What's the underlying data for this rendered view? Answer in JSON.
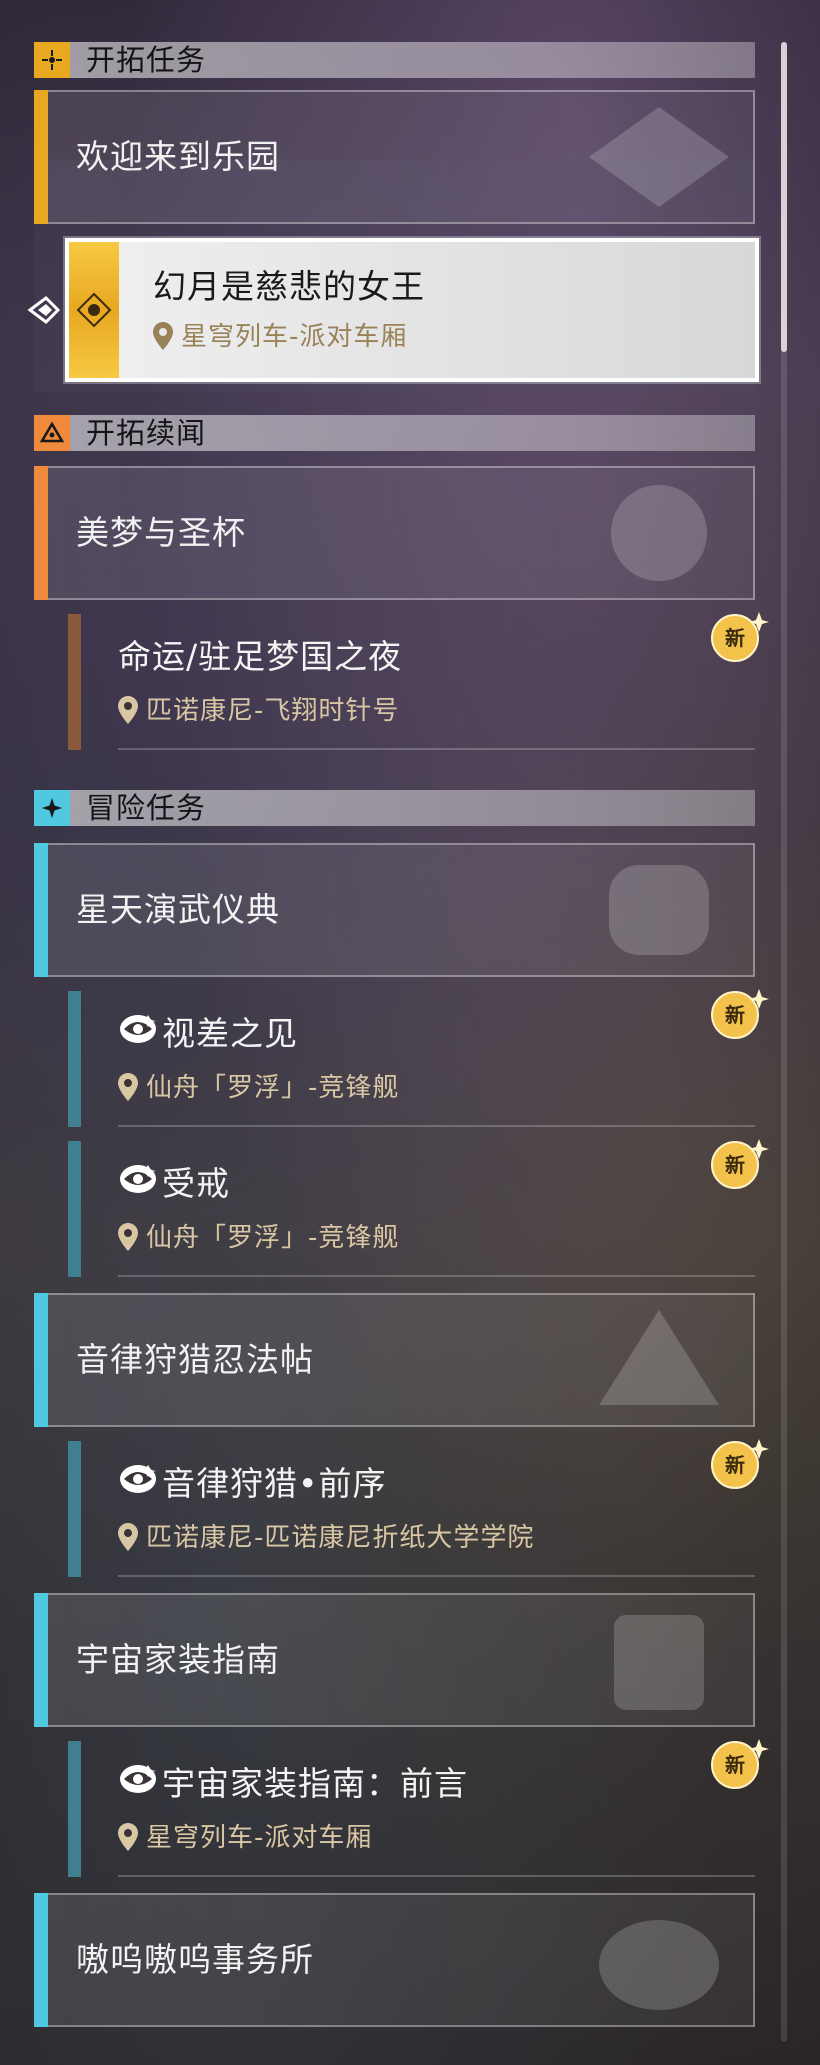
{
  "colors": {
    "trailblaze_accent": "#e8a820",
    "companion_accent": "#ef8a3c",
    "adventure_accent": "#4fc8e0",
    "location_text": "#d9c7a4",
    "new_badge": "#f3c24a"
  },
  "sections": [
    {
      "title": "开拓任务",
      "icon": "trailblaze-mission-icon",
      "missions": [
        {
          "title": "欢迎来到乐园",
          "subs": [
            {
              "title": "幻月是慈悲的女王",
              "location": "星穹列车-派对车厢",
              "active": true,
              "new": false
            }
          ]
        }
      ]
    },
    {
      "title": "开拓续闻",
      "icon": "companion-mission-icon",
      "missions": [
        {
          "title": "美梦与圣杯",
          "subs": [
            {
              "title": "命运/驻足梦国之夜",
              "location": "匹诺康尼-飞翔时针号",
              "new": true,
              "new_label": "新"
            }
          ]
        }
      ]
    },
    {
      "title": "冒险任务",
      "icon": "adventure-mission-icon",
      "missions": [
        {
          "title": "星天演武仪典",
          "subs": [
            {
              "title": "视差之见",
              "location": "仙舟「罗浮」-竞锋舰",
              "new": true,
              "new_label": "新"
            },
            {
              "title": "受戒",
              "location": "仙舟「罗浮」-竞锋舰",
              "new": true,
              "new_label": "新"
            }
          ]
        },
        {
          "title": "音律狩猎忍法帖",
          "subs": [
            {
              "title": "音律狩猎•前序",
              "location": "匹诺康尼-匹诺康尼折纸大学学院",
              "new": true,
              "new_label": "新"
            }
          ]
        },
        {
          "title": "宇宙家装指南",
          "subs": [
            {
              "title": "宇宙家装指南：前言",
              "location": "星穹列车-派对车厢",
              "new": true,
              "new_label": "新"
            }
          ]
        },
        {
          "title": "嗷呜嗷呜事务所",
          "subs": []
        }
      ]
    }
  ]
}
